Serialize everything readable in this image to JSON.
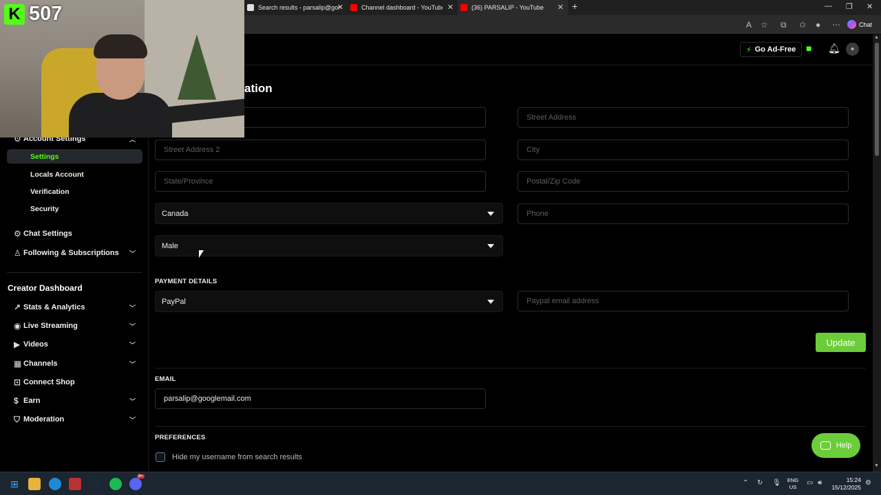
{
  "browser": {
    "tabs": [
      {
        "title": "Search results - parsalip@googlem",
        "close": "✕"
      },
      {
        "title": "Channel dashboard - YouTube Stu",
        "close": "✕"
      },
      {
        "title": "(36) PARSALIP - YouTube",
        "close": "✕"
      }
    ],
    "new_tab": "+",
    "window_controls": {
      "minimize": "—",
      "maximize": "❐",
      "close": "✕"
    },
    "copilot_label": "Chat"
  },
  "header": {
    "go_ad_free": "Go Ad-Free"
  },
  "overlay": {
    "counter_logo": "K",
    "counter_value": "507"
  },
  "page": {
    "title_fragment": "ation"
  },
  "sidebar": {
    "account_settings": "Account Settings",
    "sub_items": [
      "Settings",
      "Locals Account",
      "Verification",
      "Security"
    ],
    "chat_settings": "Chat Settings",
    "following": "Following & Subscriptions",
    "creator_dashboard": "Creator Dashboard",
    "creator_items": [
      "Stats & Analytics",
      "Live Streaming",
      "Videos",
      "Channels",
      "Connect Shop",
      "Earn",
      "Moderation"
    ]
  },
  "form": {
    "street_address_placeholder": "Street Address",
    "street_address_2_placeholder": "Street Address 2",
    "city_placeholder": "City",
    "state_placeholder": "State/Province",
    "postal_placeholder": "Postal/Zip Code",
    "country_value": "Canada",
    "phone_placeholder": "Phone",
    "gender_value": "Male",
    "payment_details_label": "PAYMENT DETAILS",
    "payment_method_value": "PayPal",
    "paypal_email_placeholder": "Paypal email address",
    "update_button": "Update",
    "email_label": "EMAIL",
    "email_value": "parsalip@googlemail.com",
    "preferences_label": "PREFERENCES",
    "hide_username_label": "Hide my username from search results"
  },
  "help_button": "Help",
  "taskbar": {
    "lang_line1": "ENG",
    "lang_line2": "US",
    "time": "15:24",
    "date": "15/12/2025",
    "discord_badge": "9+"
  },
  "colors": {
    "accent": "#53fc18",
    "button_green": "#6ccd3a",
    "background": "#000000"
  }
}
